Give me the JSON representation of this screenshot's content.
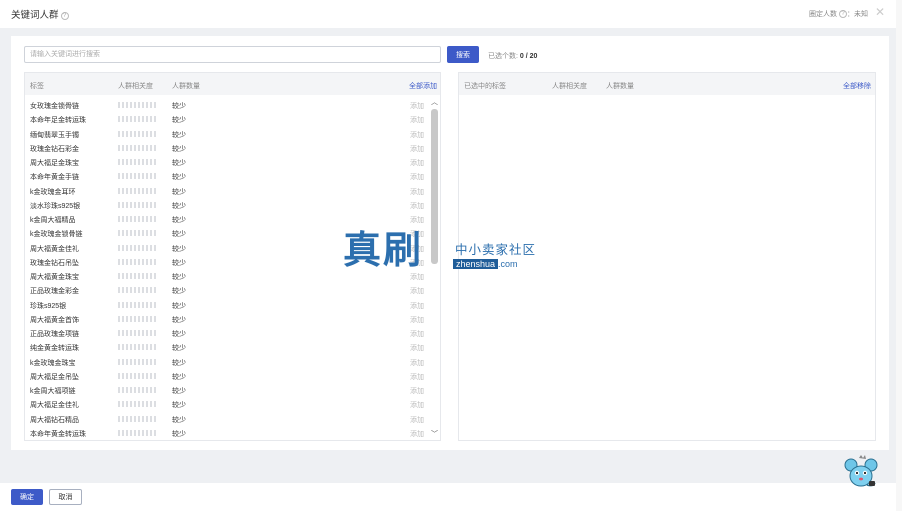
{
  "header": {
    "title": "关键词人群",
    "help_glyph": "?",
    "estimate_label": "圈定人数",
    "estimate_value": "未知",
    "close_glyph": "✕"
  },
  "search": {
    "placeholder": "请输入关键词进行搜索",
    "button_label": "搜索",
    "selected_label": "已选个数:",
    "selected_value": "0 / 20"
  },
  "left_panel": {
    "col_tag": "标签",
    "col_relevance": "人群相关度",
    "col_count": "人群数量",
    "add_all": "全部添加",
    "add_label": "添加",
    "rows": [
      {
        "name": "女玫瑰金锁骨链",
        "count": "较少"
      },
      {
        "name": "本命年足金转运珠",
        "count": "较少"
      },
      {
        "name": "缅甸翡翠玉手镯",
        "count": "较少"
      },
      {
        "name": "玫瑰金钻石彩金",
        "count": "较少"
      },
      {
        "name": "周大福足金珠宝",
        "count": "较少"
      },
      {
        "name": "本命年黄金手链",
        "count": "较少"
      },
      {
        "name": "k金玫瑰金耳环",
        "count": "较少"
      },
      {
        "name": "淡水珍珠s925银",
        "count": "较少"
      },
      {
        "name": "k金周大福精品",
        "count": "较少"
      },
      {
        "name": "k金玫瑰金锁骨链",
        "count": "较少"
      },
      {
        "name": "周大福黄金佳礼",
        "count": "较少"
      },
      {
        "name": "玫瑰金钻石吊坠",
        "count": "较少"
      },
      {
        "name": "周大福黄金珠宝",
        "count": "较少"
      },
      {
        "name": "正品玫瑰金彩金",
        "count": "较少"
      },
      {
        "name": "珍珠s925银",
        "count": "较少"
      },
      {
        "name": "周大福黄金首饰",
        "count": "较少"
      },
      {
        "name": "正品玫瑰金项链",
        "count": "较少"
      },
      {
        "name": "纯金黄金转运珠",
        "count": "较少"
      },
      {
        "name": "k金玫瑰金珠宝",
        "count": "较少"
      },
      {
        "name": "周大福足金吊坠",
        "count": "较少"
      },
      {
        "name": "k金周大福项链",
        "count": "较少"
      },
      {
        "name": "周大福足金佳礼",
        "count": "较少"
      },
      {
        "name": "周大福钻石精品",
        "count": "较少"
      },
      {
        "name": "本命年黄金转运珠",
        "count": "较少"
      }
    ]
  },
  "right_panel": {
    "col_tag": "已选中的标签",
    "col_relevance": "人群相关度",
    "col_count": "人群数量",
    "remove_all": "全部移除"
  },
  "footer": {
    "confirm_label": "确定",
    "cancel_label": "取消"
  },
  "watermark": {
    "brand": "真刷",
    "slogan": "中小卖家社区",
    "domain_part1": "zhenshua",
    "domain_part2": ".com"
  },
  "colors": {
    "primary": "#3d5ac8",
    "watermark": "#2c6fae"
  },
  "icons": {
    "help": "help-circle-icon",
    "close": "close-icon",
    "scroll_up": "chevron-up-icon",
    "scroll_down": "chevron-down-icon",
    "mascot": "mascot-icon"
  }
}
